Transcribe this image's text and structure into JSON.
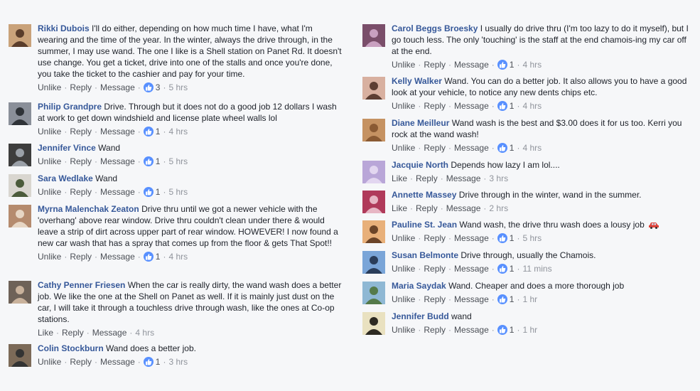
{
  "colors": {
    "name": "#365899",
    "link": "#4b4f56",
    "meta": "#90949c",
    "like": "#5890ff",
    "bg": "#f6f7f9"
  },
  "left": [
    {
      "name": "Rikki Dubois",
      "text": "I'll do either, depending on how much time I have, what I'm wearing and the time of the year. In the winter, always the drive through, in the summer, I may use wand. The one I like is a Shell station on Panet Rd. It doesn't use change. You get a ticket, drive into one of the stalls and once you're done, you take the ticket to the cashier and pay for your time.",
      "primary": "Unlike",
      "reply": "Reply",
      "message": "Message",
      "likes": "3",
      "time": "5 hrs"
    },
    {
      "name": "Philip Grandpre",
      "text": "Drive. Through but it does not do a good job 12 dollars I wash at work to get down windshield and license plate wheel walls lol",
      "primary": "Unlike",
      "reply": "Reply",
      "message": "Message",
      "likes": "1",
      "time": "4 hrs"
    },
    {
      "name": "Jennifer Vince",
      "text": "Wand",
      "primary": "Unlike",
      "reply": "Reply",
      "message": "Message",
      "likes": "1",
      "time": "5 hrs"
    },
    {
      "name": "Sara Wedlake",
      "text": "Wand",
      "primary": "Unlike",
      "reply": "Reply",
      "message": "Message",
      "likes": "1",
      "time": "5 hrs"
    },
    {
      "name": "Myrna Malenchak Zeaton",
      "text": "Drive thru until we got a newer vehicle with the 'overhang' above rear window. Drive thru couldn't clean under there & would leave a strip of dirt across upper part of rear window. HOWEVER! I now found a new car wash that has a spray that comes up from the floor & gets That Spot!!",
      "primary": "Unlike",
      "reply": "Reply",
      "message": "Message",
      "likes": "1",
      "time": "4 hrs"
    },
    {
      "name": "Cathy Penner Friesen",
      "text": "When the car is really dirty, the wand wash does a better job. We like the one at the Shell on Panet as well. If it is mainly just dust on the car, I will take it through a touchless drive through wash, like the ones at Co-op stations.",
      "primary": "Like",
      "reply": "Reply",
      "message": "Message",
      "likes": "",
      "time": "4 hrs"
    },
    {
      "name": "Colin Stockburn",
      "text": "Wand does a better job.",
      "primary": "Unlike",
      "reply": "Reply",
      "message": "Message",
      "likes": "1",
      "time": "3 hrs"
    }
  ],
  "right": [
    {
      "name": "Carol Beggs Broesky",
      "text": "I usually do drive thru (I'm too lazy to do it myself), but I go touch less. The only 'touching' is the staff at the end chamois-ing my car off at the end.",
      "primary": "Unlike",
      "reply": "Reply",
      "message": "Message",
      "likes": "1",
      "time": "4 hrs"
    },
    {
      "name": "Kelly Walker",
      "text": "Wand. You can do a better job. It also allows you to have a good look at your vehicle, to notice any new dents chips etc.",
      "primary": "Unlike",
      "reply": "Reply",
      "message": "Message",
      "likes": "1",
      "time": "4 hrs"
    },
    {
      "name": "Diane Meilleur",
      "text": "Wand wash is the best and $3.00 does it for us too. Kerri you rock at the wand wash!",
      "primary": "Unlike",
      "reply": "Reply",
      "message": "Message",
      "likes": "1",
      "time": "4 hrs"
    },
    {
      "name": "Jacquie North",
      "text": "Depends how lazy I am lol....",
      "primary": "Like",
      "reply": "Reply",
      "message": "Message",
      "likes": "",
      "time": "3 hrs"
    },
    {
      "name": "Annette Massey",
      "text": "Drive through in the winter, wand in the summer.",
      "primary": "Like",
      "reply": "Reply",
      "message": "Message",
      "likes": "",
      "time": "2 hrs"
    },
    {
      "name": "Pauline St. Jean",
      "text": "Wand wash, the drive thru wash does a lousy job",
      "primary": "Unlike",
      "reply": "Reply",
      "message": "Message",
      "likes": "1",
      "time": "5 hrs",
      "emoji": "car-icon"
    },
    {
      "name": "Susan Belmonte",
      "text": "Drive through, usually the Chamois.",
      "primary": "Unlike",
      "reply": "Reply",
      "message": "Message",
      "likes": "1",
      "time": "11 mins"
    },
    {
      "name": "Maria Saydak",
      "text": "Wand. Cheaper and does a more thorough job",
      "primary": "Unlike",
      "reply": "Reply",
      "message": "Message",
      "likes": "1",
      "time": "1 hr"
    },
    {
      "name": "Jennifer Budd",
      "text": "wand",
      "primary": "Unlike",
      "reply": "Reply",
      "message": "Message",
      "likes": "1",
      "time": "1 hr"
    }
  ]
}
